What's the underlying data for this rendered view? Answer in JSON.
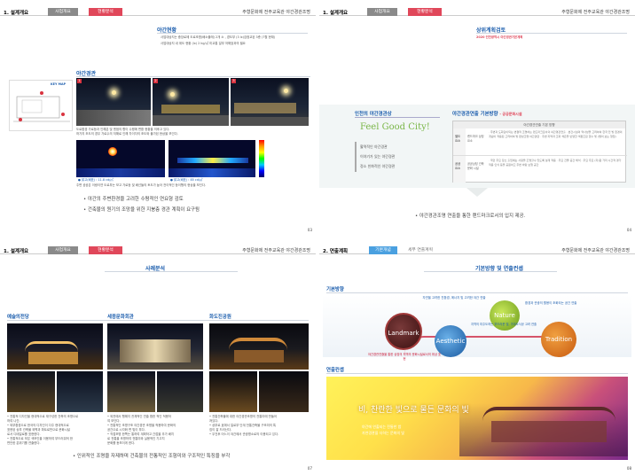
{
  "doc_title": "주형문화제 전주교육관 야간경관조명",
  "pages": [
    {
      "section": "1. 설계개요",
      "tab1": "사업개요",
      "tab2": "현황분석",
      "heading1": "야간현황",
      "line1": "사업대상지는 중앙로에 도로조명(배소플래) 2개 소 , 경도부 (3 lx)검정교된 3층 (7월 현재)",
      "line2": "사업대상지 내 위도 현황 (lx) 2 kg/㎡ 미교통 일부 저해효과의 필요",
      "heading2": "야간경관",
      "keymap": "KEY MAP",
      "p1": "1",
      "p2": "2",
      "p3": "3",
      "caption1": "도로환경 가로등과 인해분 및 엔점의 향이 수평에 변환 현황을 의후고 있다.",
      "caption2": "하가지 조도의 경우 가로수의 저해로 인해 차이자의 조도와 불가된 현상을 보인다.",
      "viz1": "● 밝고(배표) : 11.8 cd/㎡",
      "viz2": "● 밝고(배표) : 85 cd/㎡",
      "caption3": "주변 공공은 이랑이연 도로부는 보고 가로등 및 배선들의 토도가 높아 전이적인 등이행의 현상을 보인다.",
      "bullet1": "• 야간의 주변환경을 고려한 수평적인 연요형 검토",
      "bullet2": "• 건축물의 원기의 조망을 위한 지붕층 경관 계획이 요구됨",
      "page_num": "03"
    },
    {
      "section": "1. 설계개요",
      "tab1": "사업개요",
      "tab2": "현황분석",
      "heading": "상위계획검토",
      "subheading": "2020 인천광역시 야간경관기본계획",
      "left_title": "인천의 야간경관상",
      "slogan": "Feel Good City!",
      "items": [
        "활력적인 야간경관",
        "이야기가 있는 야간경관",
        "정소 친화적인 야간경관"
      ],
      "right_title": "야간경관연출 기본방향",
      "right_tag": "- 공공문화시설",
      "table_head": "야간경관연출 기본 방향",
      "row1_label": "별도 요소",
      "row1_sub": "랜드마크 상징요소",
      "row1_text": "· 주변과 도화감이되는 변결적 조명하는 랜드마크로서의 야간경관연출 · 본건시설의 역사성을 고려하여 한국 전 빛 환경의 개념이 적용된 고려하여 빛 편성조명 야간경관 · 주변 지역과 조화 색온을 반영한 색편조된 향수 빛 (별의 보는 형임)",
      "row2_label": "공공 요소",
      "row2_sub": "공공상징 건축문화 시설",
      "row2_text": "· 국민 주요 장소 출입에는 사렁을 조명할수 있도록 설계 적용 · 주요 건물 공간 해석 · 주요 주요 (자)원 거리 시간적 경가적용 인식 등을 공원하고 주변 바탕 보행 공간",
      "bullet": "• 야간경관조명 연출을 통한 랜드마크로서의 입지 제공.",
      "page_num": "04"
    },
    {
      "section": "1. 설계개요",
      "tab1": "사업개요",
      "tab2": "현황분석",
      "heading": "사례분석",
      "cols": [
        {
          "title": "예술의전당",
          "lines": [
            "• 전통적 디자인을 현대적으로 재구성한 건축의 조명으로",
            "  하여 나간.",
            "• 외부환경으로 한국의 디자인이 다주 현대적으로",
            "  표현된 상부 건축물 외벽과 파트로만으로 문화시설",
            "  로서 디테일로를 표현한다.",
            "• 전통적으로 보은 색조인을 이용하여 부드러워져 한",
            "  편안한 분위기를 연출한다."
          ]
        },
        {
          "title": "세종문화회관",
          "lines": [
            "• 외관에서 행해지 관체적인 연출 합한 적인 적용하",
            "  여 보인다.",
            "• 전통적인 조명구조 야간경관 조명을 적용하여 문화의",
            "  공간으로 시각화 면 빛이 부다.",
            "• 직접조명 한쪽는 통하여 계획하고 간접을 추가 배치",
            "  로 전통을 조명하여 전통미와 실용적인 기고치",
            "  문화를 돋보이게 한다."
          ]
        },
        {
          "title": "화도진공원",
          "lines": [
            "• 전통건축물에 대한 야간경관조명의 전통미에 만들어",
            "  져있다.",
            "• 상부로 효에서 일로부 단계 전통건축물 구조미의 특",
            "  징이 잘 드러난다.",
            "• 우건후 어느이 야간에서 관광명소로의 이용되고 있다."
          ]
        }
      ],
      "bullet": "• 인위적인 조명을 자제하며 건축물의 전통적인 조형미와 구조적인 특징을 부각",
      "page_num": "07"
    },
    {
      "section": "2. 연출계획",
      "tab1": "기본개념",
      "tab2": "세부 연출계획",
      "heading": "기본방향 및 연출컨셉",
      "sec1": "기본방향",
      "circles": [
        "Landmark",
        "Nature",
        "Aesthetic",
        "Tradition"
      ],
      "notes": [
        "자연을 고려한 친환경, 에너지 빛 고려한 야간 연출",
        "환경과 관광의 활용이 조화되는 공간 연출",
        "야간경관연출을 통한 상징의 지역의 문화시설로서의 위상 표현",
        "지역의 미주도하는 부드러운 빛, 가야도식공 고려 연출"
      ],
      "sec2": "연출컨셉",
      "concept_title": "비, 찬란한 빛으로 물든 문화의 빛",
      "concept_sub1": "야간에 연출되는 전통한 밤",
      "concept_sub2": "자연경관을 더하는 문화의 빛",
      "page_num": "08"
    }
  ]
}
